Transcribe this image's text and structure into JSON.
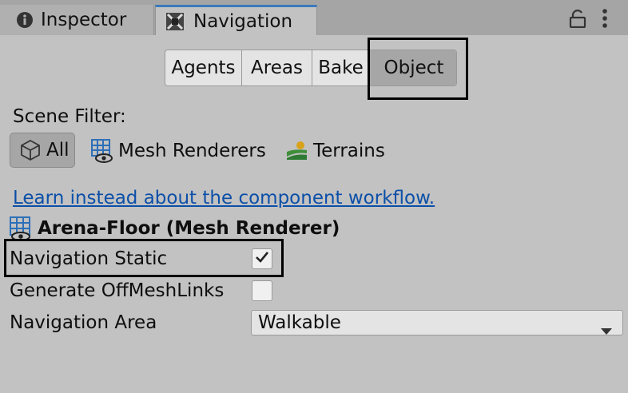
{
  "tabs": {
    "inspector": "Inspector",
    "navigation": "Navigation"
  },
  "toolbar": {
    "lock_icon": "lock-icon",
    "more_icon": "more-vertical-icon"
  },
  "segments": {
    "agents": "Agents",
    "areas": "Areas",
    "bake": "Bake",
    "object": "Object",
    "selected": "Object"
  },
  "scene_filter": {
    "label": "Scene Filter:",
    "all": "All",
    "mesh_renderers": "Mesh Renderers",
    "terrains": "Terrains",
    "selected": "All"
  },
  "link_text": "Learn instead about the component workflow.",
  "object": {
    "title": "Arena-Floor (Mesh Renderer)",
    "navigation_static_label": "Navigation Static",
    "navigation_static_checked": true,
    "generate_offmeshlinks_label": "Generate OffMeshLinks",
    "generate_offmeshlinks_checked": false,
    "navigation_area_label": "Navigation Area",
    "navigation_area_value": "Walkable"
  },
  "colors": {
    "accent_tab": "#3a79bb",
    "link": "#0b4fa8",
    "panel_bg": "#c2c2c2",
    "selected_segment": "#a6a6a6"
  }
}
